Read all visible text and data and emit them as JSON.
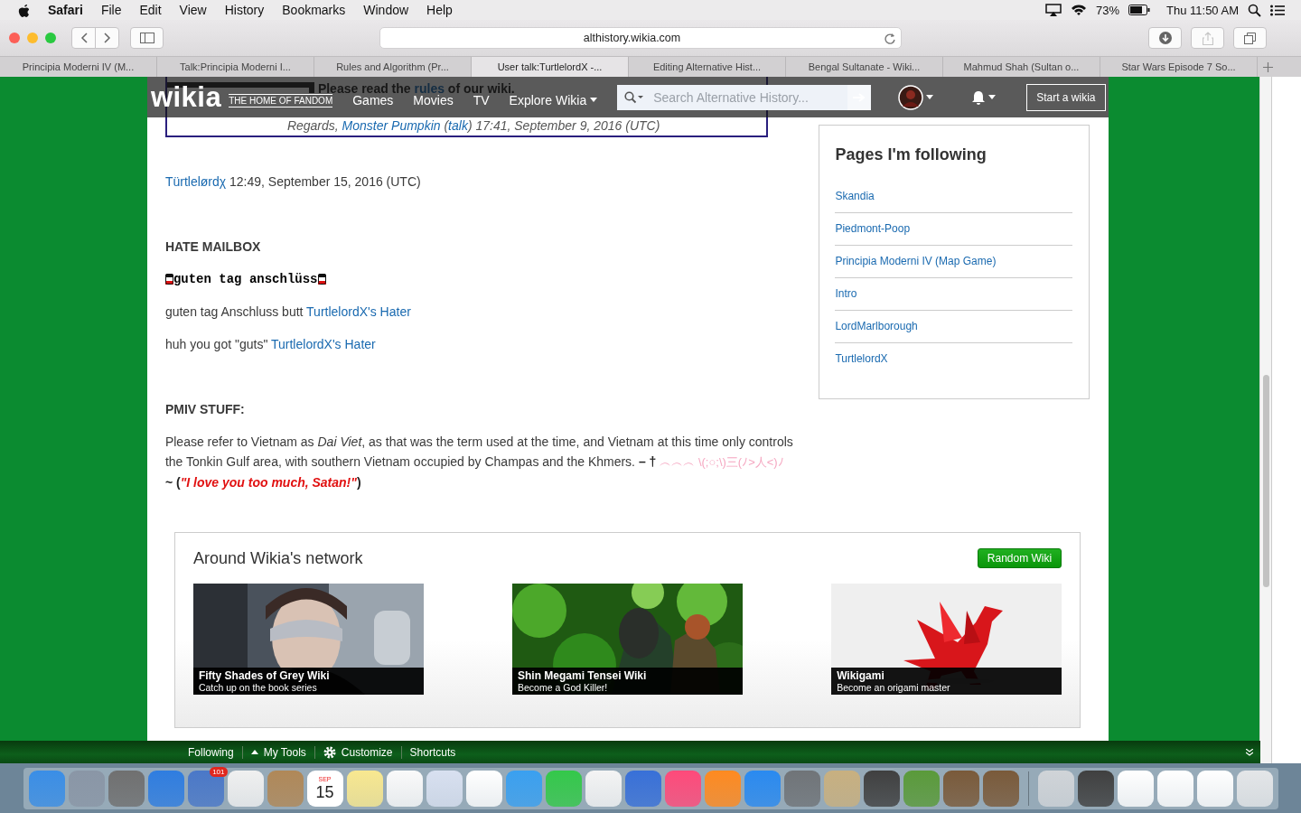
{
  "menubar": {
    "app": "Safari",
    "menus": [
      "File",
      "Edit",
      "View",
      "History",
      "Bookmarks",
      "Window",
      "Help"
    ],
    "battery": "73%",
    "clock": "Thu 11:50 AM"
  },
  "toolbar": {
    "address": "althistory.wikia.com"
  },
  "tabs": [
    {
      "label": "Principia Moderni IV (M...",
      "selected": false
    },
    {
      "label": "Talk:Principia Moderni I...",
      "selected": false
    },
    {
      "label": "Rules and Algorithm (Pr...",
      "selected": false
    },
    {
      "label": "User talk:TurtlelordX -...",
      "selected": true
    },
    {
      "label": "Editing Alternative Hist...",
      "selected": false
    },
    {
      "label": "Bengal Sultanate - Wiki...",
      "selected": false
    },
    {
      "label": "Mahmud Shah (Sultan o...",
      "selected": false
    },
    {
      "label": "Star Wars Episode 7 So...",
      "selected": false
    }
  ],
  "notice": {
    "lines": [
      {
        "kind": "bullet",
        "parts": [
          {
            "text": "Please read the ",
            "kind": "bold"
          },
          {
            "text": "rules",
            "kind": "boldlink"
          },
          {
            "text": " of our wiki.",
            "kind": "bold"
          }
        ]
      },
      {
        "kind": "regards",
        "parts": [
          {
            "text": "Regards, ",
            "kind": "plain"
          },
          {
            "text": "Monster Pumpkin",
            "kind": "link"
          },
          {
            "text": " (",
            "kind": "plain"
          },
          {
            "text": "talk",
            "kind": "link"
          },
          {
            "text": ") 17:41, September 9, 2016 (UTC)",
            "kind": "plain"
          }
        ]
      }
    ]
  },
  "wikia_bar": {
    "logo": "wikia",
    "tagline": "THE HOME OF FANDOM",
    "links": [
      {
        "label": "Games",
        "menu": false
      },
      {
        "label": "Movies",
        "menu": false
      },
      {
        "label": "TV",
        "menu": false
      },
      {
        "label": "Explore Wikia",
        "menu": true
      }
    ],
    "search": {
      "placeholder": "Search Alternative History..."
    },
    "start_button": "Start a wikia"
  },
  "content": [
    {
      "kind": "signature",
      "parts": [
        {
          "text": "Türtlelørdχ",
          "kind": "link"
        },
        {
          "text": " 12:49, September 15, 2016 (UTC)",
          "kind": "plain"
        }
      ]
    },
    {
      "kind": "heading",
      "text": "HATE MAILBOX"
    },
    {
      "kind": "banner",
      "text": "guten tag anschlüss"
    },
    {
      "kind": "paragraph",
      "parts": [
        {
          "text": "guten tag Anschluss butt ",
          "kind": "plain"
        },
        {
          "text": "TurtlelordX's Hater",
          "kind": "link"
        }
      ]
    },
    {
      "kind": "paragraph",
      "parts": [
        {
          "text": "huh you got \"guts\" ",
          "kind": "plain"
        },
        {
          "text": "TurtlelordX's Hater",
          "kind": "link"
        }
      ]
    },
    {
      "kind": "heading",
      "text": "PMIV STUFF:"
    },
    {
      "kind": "paragraph",
      "parts": [
        {
          "text": "Please refer to Vietnam as ",
          "kind": "plain"
        },
        {
          "text": "Dai Viet",
          "kind": "italic"
        },
        {
          "text": ", as that was the term used at the time, and Vietnam at this time only controls the Tonkin Gulf area, with southern Vietnam occupied by Champas and the Khmers. ",
          "kind": "plain"
        },
        {
          "text": "– † ",
          "kind": "bold"
        },
        {
          "text": "︵︵︵ \\(;○;\\)三(ﾉ>人<)ﾉ",
          "kind": "pink"
        },
        {
          "text": " ~ (",
          "kind": "bold"
        },
        {
          "text": "\"I love you too much, Satan!\"",
          "kind": "red"
        },
        {
          "text": ")",
          "kind": "bold"
        }
      ]
    }
  ],
  "sidebar": {
    "title": "Pages I'm following",
    "items": [
      "Skandia",
      "Piedmont-Poop",
      "Principia Moderni IV (Map Game)",
      "Intro",
      "LordMarlborough",
      "TurtlelordX"
    ]
  },
  "network": {
    "title": "Around Wikia's network",
    "button": "Random Wiki",
    "cards": [
      {
        "title": "Fifty Shades of Grey Wiki",
        "subtitle": "Catch up on the book series",
        "kind": "figure"
      },
      {
        "title": "Shin Megami Tensei Wiki",
        "subtitle": "Become a God Killer!",
        "kind": "jungle"
      },
      {
        "title": "Wikigami",
        "subtitle": "Become an origami master",
        "kind": "origami"
      }
    ]
  },
  "footer": [
    {
      "label": "Following",
      "kind": "plain"
    },
    {
      "label": "My Tools",
      "kind": "menu"
    },
    {
      "label": "Customize",
      "kind": "settings"
    },
    {
      "label": "Shortcuts",
      "kind": "plain"
    }
  ],
  "dock": {
    "mail_badge": "101",
    "calendar_month": "SEP",
    "calendar_day": "15"
  }
}
